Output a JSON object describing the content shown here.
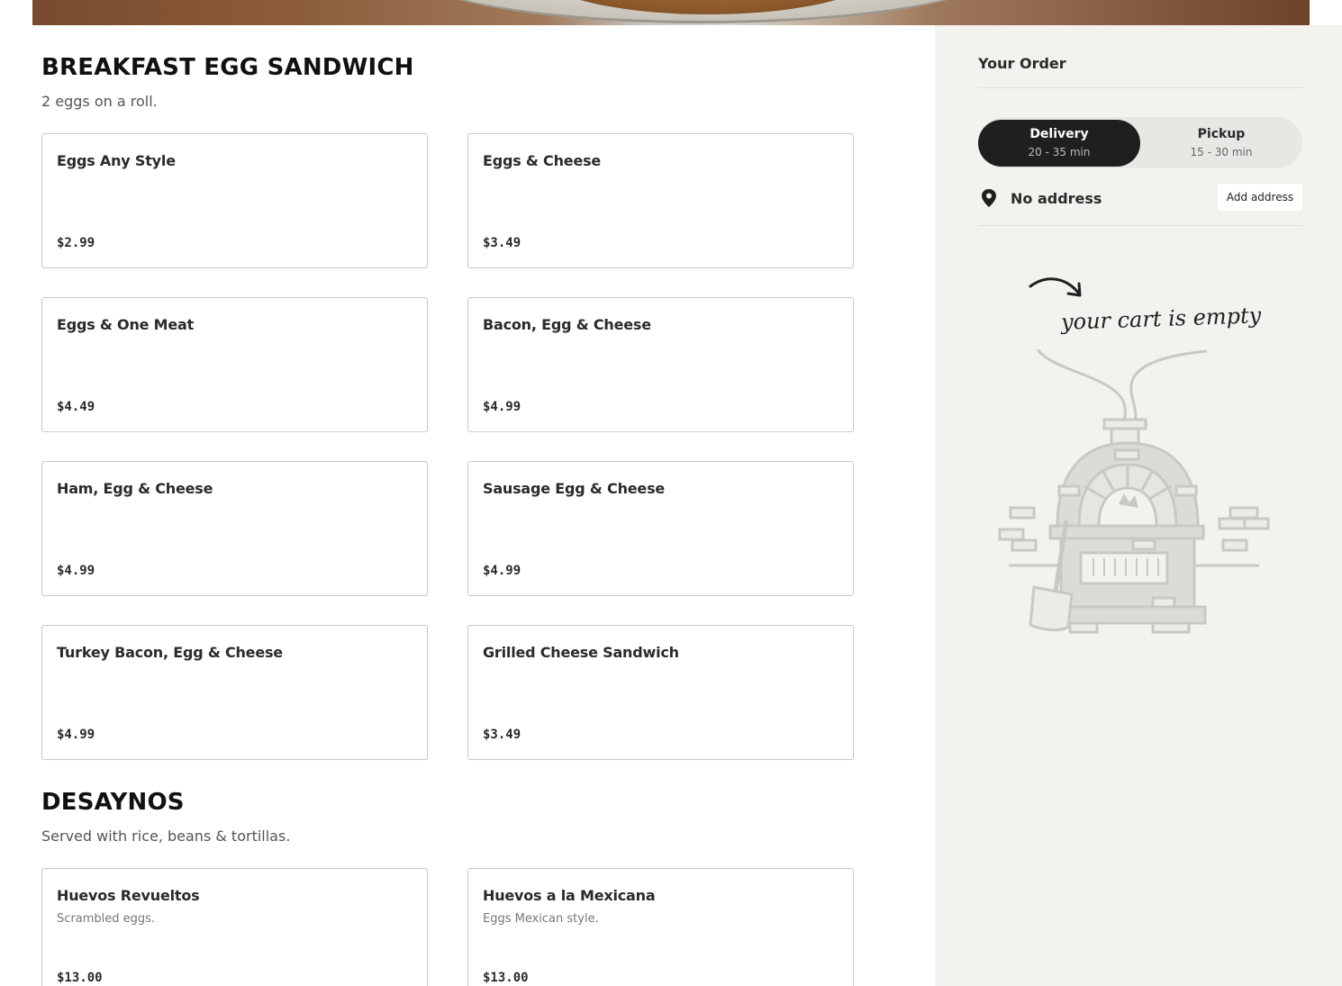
{
  "sections": [
    {
      "title": "BREAKFAST EGG SANDWICH",
      "description": "2 eggs on a roll.",
      "items": [
        {
          "name": "Eggs Any Style",
          "price": "$2.99"
        },
        {
          "name": "Eggs & Cheese",
          "price": "$3.49"
        },
        {
          "name": "Eggs & One Meat",
          "price": "$4.49"
        },
        {
          "name": "Bacon, Egg & Cheese",
          "price": "$4.99"
        },
        {
          "name": "Ham, Egg & Cheese",
          "price": "$4.99"
        },
        {
          "name": "Sausage Egg & Cheese",
          "price": "$4.99"
        },
        {
          "name": "Turkey Bacon, Egg & Cheese",
          "price": "$4.99"
        },
        {
          "name": "Grilled Cheese Sandwich",
          "price": "$3.49"
        }
      ]
    },
    {
      "title": "DESAYNOS",
      "description": "Served with rice, beans & tortillas.",
      "items": [
        {
          "name": "Huevos Revueltos",
          "description": "Scrambled eggs.",
          "price": "$13.00"
        },
        {
          "name": "Huevos a la Mexicana",
          "description": "Eggs Mexican style.",
          "price": "$13.00"
        }
      ]
    }
  ],
  "order": {
    "title": "Your Order",
    "delivery": {
      "label": "Delivery",
      "time": "20 - 35 min",
      "selected": true
    },
    "pickup": {
      "label": "Pickup",
      "time": "15 - 30 min",
      "selected": false
    },
    "address_label": "No address",
    "add_address_button": "Add address",
    "empty_cart_text": "your cart is empty"
  },
  "icons": {
    "pin": "map-pin-icon",
    "arrow": "curved-arrow-icon",
    "oven": "pizza-oven-illustration"
  },
  "colors": {
    "accent_dark": "#1f1f1f",
    "sidebar_bg": "#f3f2ef"
  }
}
